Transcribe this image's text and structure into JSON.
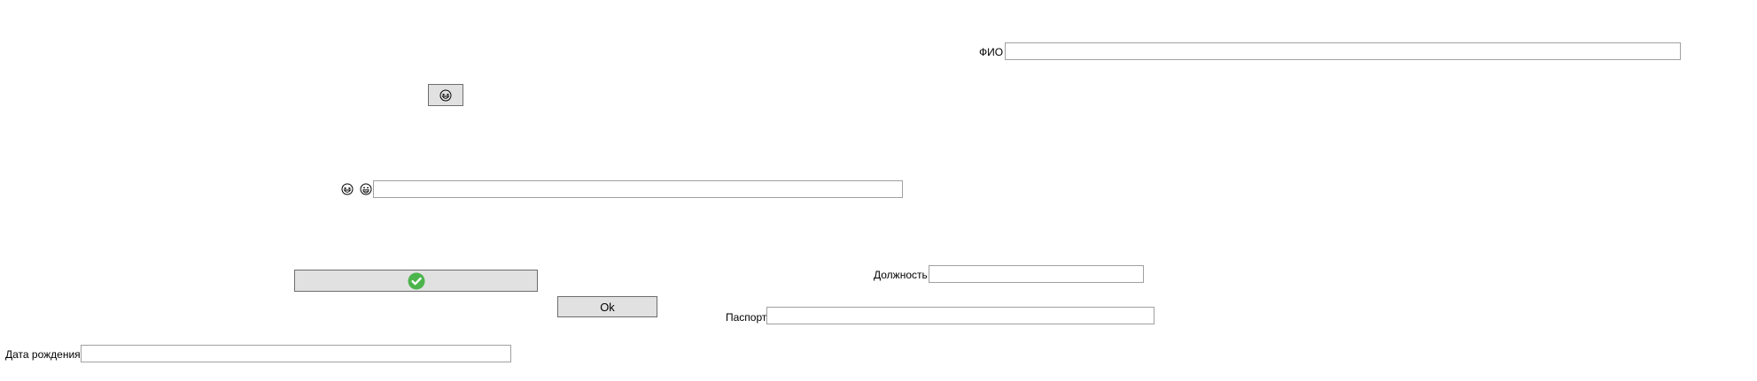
{
  "form": {
    "fio_label": "ФИО",
    "fio_value": "",
    "position_label": "Должность",
    "position_value": "",
    "passport_label": "Паспорт",
    "passport_value": "",
    "birthdate_label": "Дата рождения",
    "birthdate_value": "",
    "emoji_input_value": "",
    "ok_label": "Ok"
  },
  "icons": {
    "emoji_button_icon": "grinning-squint-face-icon",
    "emoji_label_icons": [
      "grinning-squint-face-icon",
      "grinning-face-icon"
    ],
    "confirm_button_icon": "check-circle-icon"
  },
  "colors": {
    "confirm_green": "#4cb44c",
    "button_face": "#e1e1e1",
    "field_border": "#a0a0a0"
  }
}
